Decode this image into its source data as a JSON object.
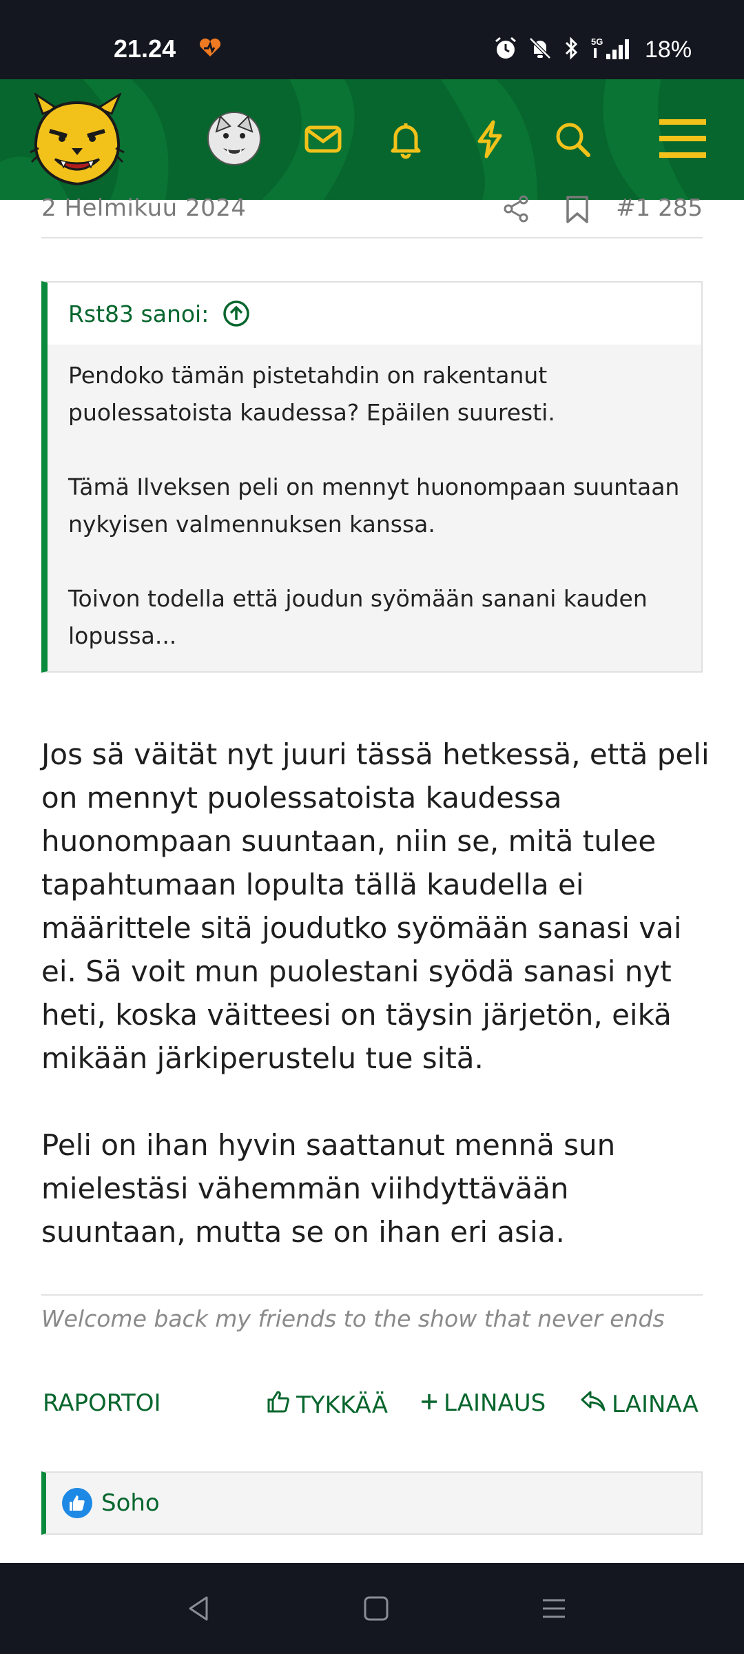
{
  "status_bar": {
    "time": "21.24",
    "battery": "18%",
    "icons": [
      "heart-signal-icon",
      "alarm-icon",
      "bell-muted-icon",
      "bluetooth-icon",
      "5g-icon",
      "signal-icon"
    ]
  },
  "header": {
    "icons": [
      "lynx-logo",
      "avatar",
      "mail-icon",
      "bell-icon",
      "bolt-icon",
      "search-icon",
      "menu-icon"
    ],
    "colors": {
      "background": "#07662d",
      "icon": "#f2c21b"
    }
  },
  "post": {
    "date": "2 Helmikuu 2024",
    "number": "#1 285",
    "quote": {
      "author_line": "Rst83 sanoi:",
      "paragraphs": [
        "Pendoko tämän pistetahdin on rakentanut puolessatoista kaudessa? Epäilen suuresti.",
        "Tämä Ilveksen peli on mennyt huonompaan suuntaan nykyisen valmennuksen kanssa.",
        "Toivon todella että joudun syömään sanani kauden lopussa..."
      ]
    },
    "body": [
      "Jos sä väität nyt juuri tässä hetkessä, että peli on mennyt puolessatoista kaudessa huonompaan suuntaan, niin se, mitä tulee tapahtumaan lopulta tällä kaudella ei määrittele sitä joudutko syömään sanasi vai ei. Sä voit mun puolestani syödä sanasi nyt heti, koska väitteesi on täysin järjetön, eikä mikään järkiperustelu tue sitä.",
      "Peli on ihan hyvin saattanut mennä sun mielestäsi vähemmän viihdyttävään suuntaan, mutta se on ihan eri asia."
    ],
    "signature": "Welcome back my friends to the show that never ends",
    "actions": {
      "report": "RAPORTOI",
      "like": "TYKKÄÄ",
      "multiquote": "LAINAUS",
      "reply": "LAINAA"
    },
    "reactions": {
      "users": "Soho"
    },
    "colors": {
      "accent": "#07662d",
      "quote_bar": "#0a8a3c"
    }
  }
}
